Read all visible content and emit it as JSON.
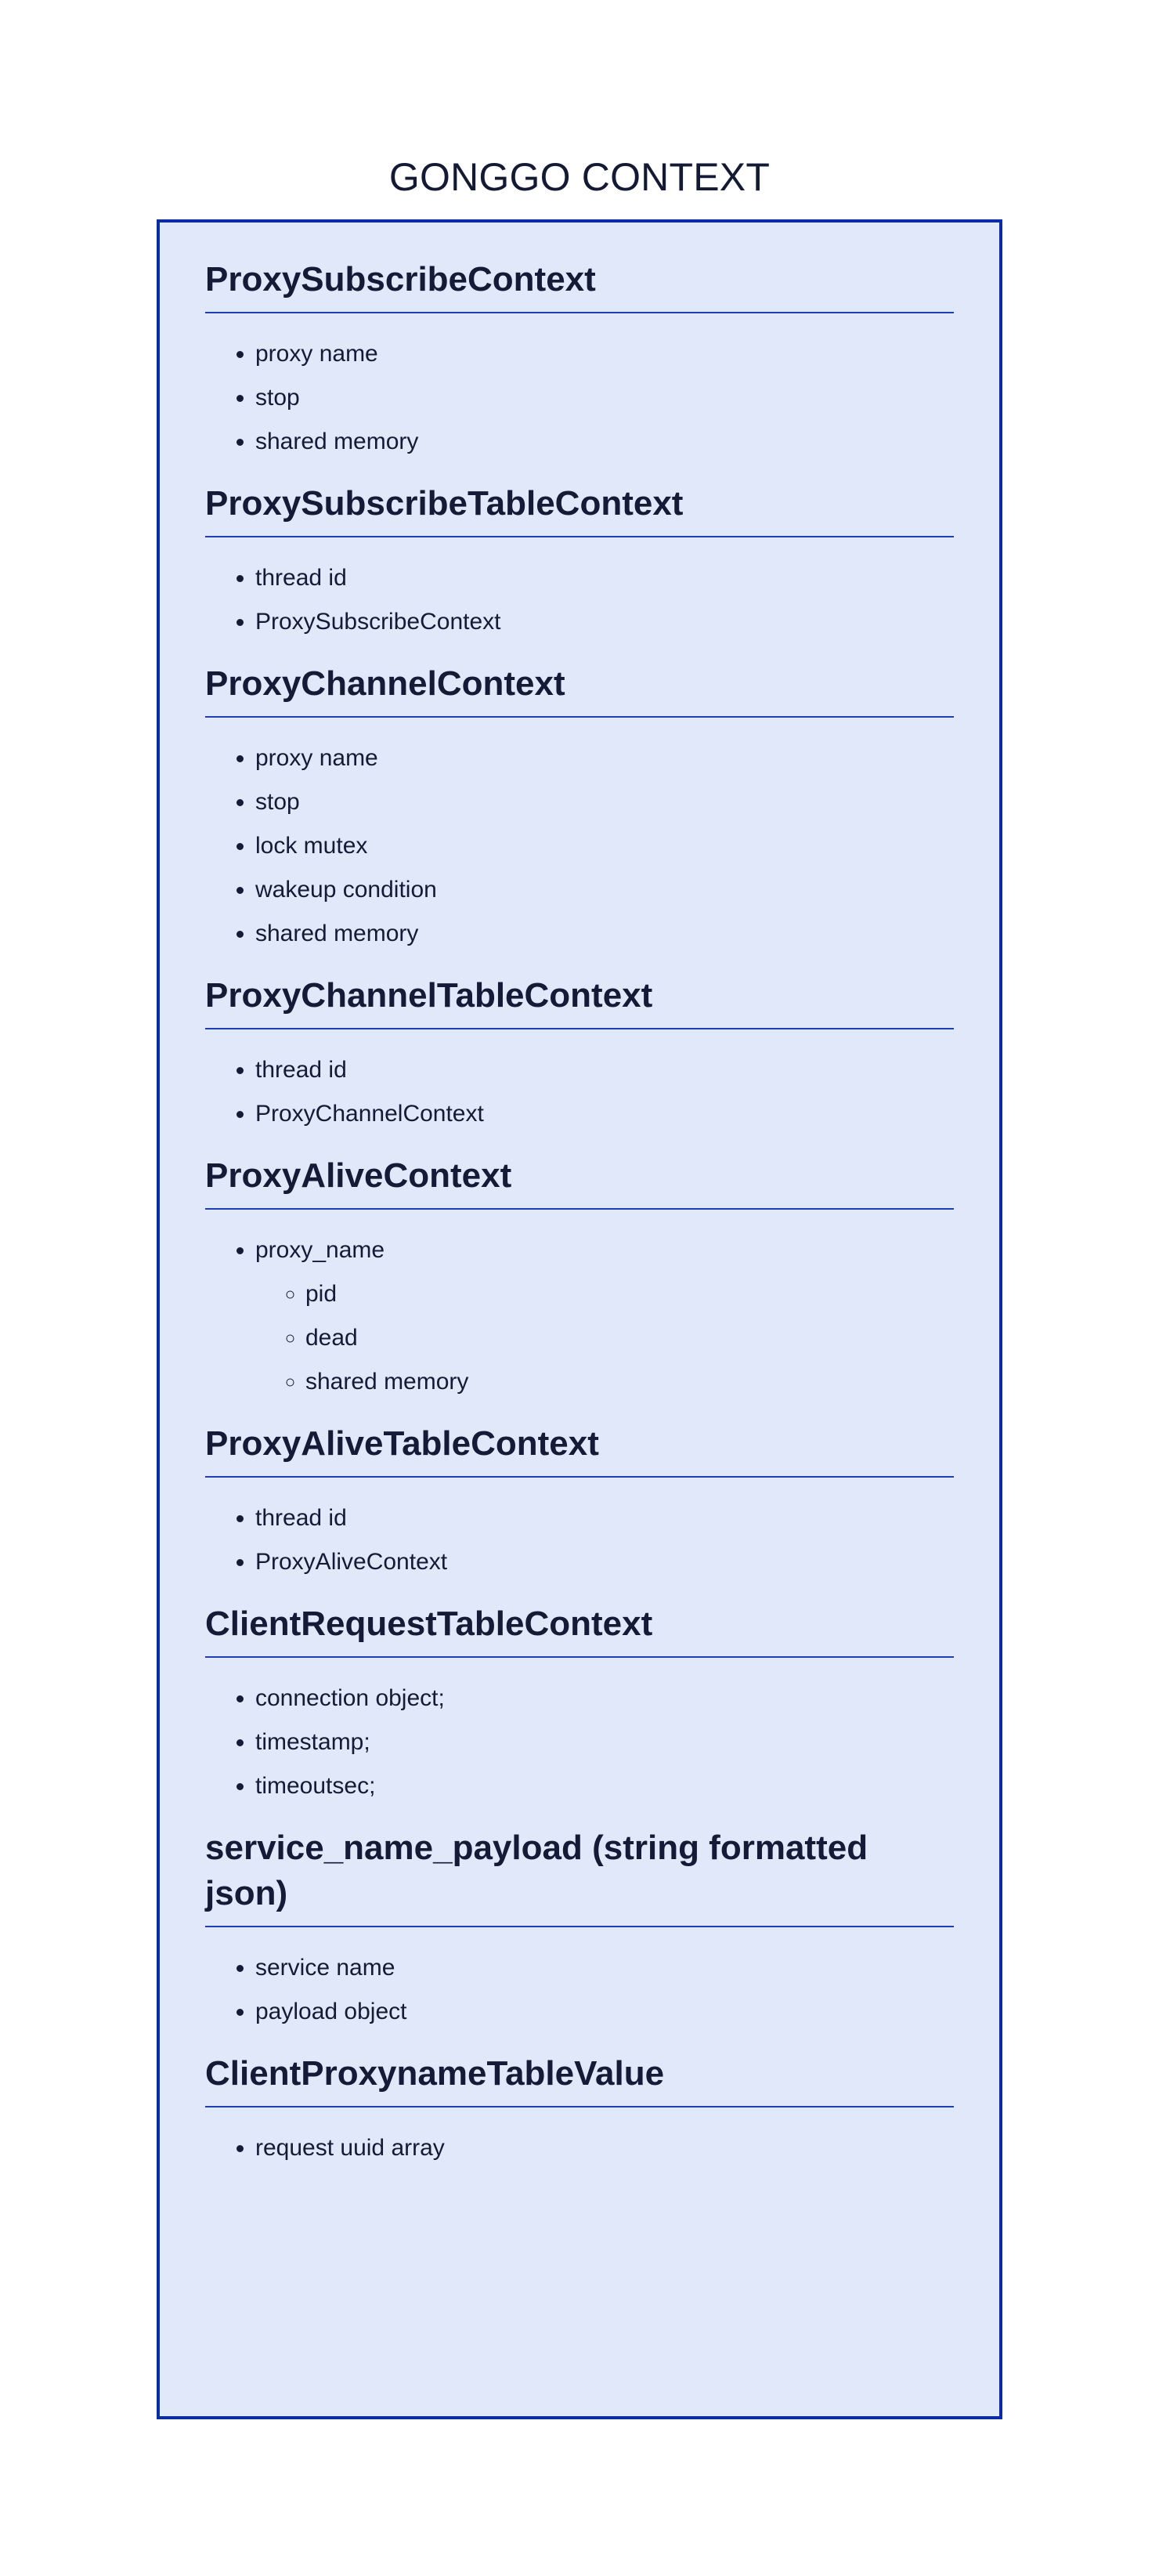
{
  "title": "GONGGO CONTEXT",
  "sections": [
    {
      "heading": "ProxySubscribeContext",
      "items": [
        "proxy name",
        "stop",
        "shared memory"
      ]
    },
    {
      "heading": "ProxySubscribeTableContext",
      "items": [
        "thread id",
        "ProxySubscribeContext"
      ]
    },
    {
      "heading": "ProxyChannelContext",
      "items": [
        "proxy name",
        "stop",
        "lock mutex",
        "wakeup condition",
        "shared memory"
      ]
    },
    {
      "heading": "ProxyChannelTableContext",
      "items": [
        "thread id",
        "ProxyChannelContext"
      ]
    },
    {
      "heading": "ProxyAliveContext",
      "items": [
        "proxy_name"
      ],
      "subitems": [
        "pid",
        "dead",
        "shared memory"
      ]
    },
    {
      "heading": "ProxyAliveTableContext",
      "items": [
        "thread id",
        "ProxyAliveContext"
      ]
    },
    {
      "heading": "ClientRequestTableContext",
      "items": [
        "connection object;",
        "timestamp;",
        "timeoutsec;"
      ]
    },
    {
      "heading": "service_name_payload (string formatted json)",
      "items": [
        "service name",
        "payload object"
      ]
    },
    {
      "heading": "ClientProxynameTableValue",
      "items": [
        "request uuid array"
      ]
    }
  ]
}
